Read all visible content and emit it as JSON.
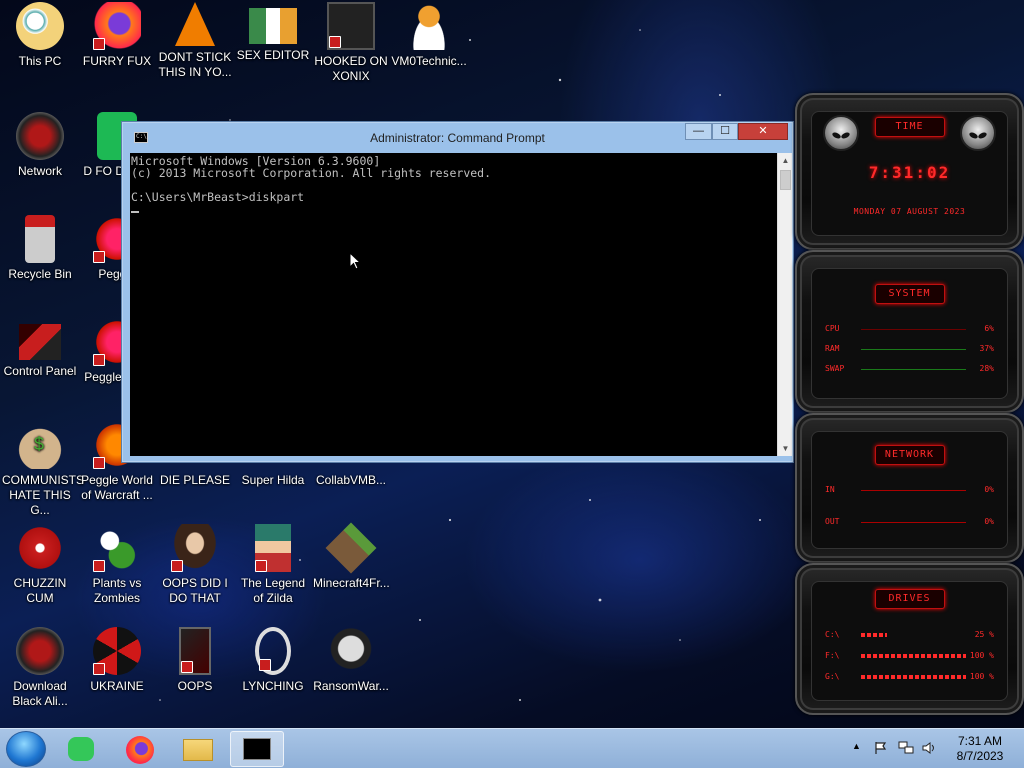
{
  "desktop": {
    "icons": [
      {
        "label": "This PC"
      },
      {
        "label": "FURRY FUX"
      },
      {
        "label": "DONT STICK THIS IN YO..."
      },
      {
        "label": "SEX EDITOR"
      },
      {
        "label": "HOOKED ON XONIX"
      },
      {
        "label": "VM0Technic..."
      },
      {
        "label": "Network"
      },
      {
        "label": "D FO DUMB"
      },
      {
        "label": "Recycle Bin"
      },
      {
        "label": "Peggle"
      },
      {
        "label": "Control Panel"
      },
      {
        "label": "Peggle Delu"
      },
      {
        "label": "COMMUNISTS HATE THIS G..."
      },
      {
        "label": "Peggle World of Warcraft ..."
      },
      {
        "label": "DIE PLEASE"
      },
      {
        "label": "Super Hilda"
      },
      {
        "label": "CollabVMB..."
      },
      {
        "label": "CHUZZIN CUM"
      },
      {
        "label": "Plants vs Zombies"
      },
      {
        "label": "OOPS DID I DO THAT"
      },
      {
        "label": "The Legend of Zilda"
      },
      {
        "label": "Minecraft4Fr..."
      },
      {
        "label": "Download Black Ali..."
      },
      {
        "label": "UKRAINE"
      },
      {
        "label": "OOPS"
      },
      {
        "label": "LYNCHING"
      },
      {
        "label": "RansomWar..."
      }
    ]
  },
  "cmd": {
    "title": "Administrator: Command Prompt",
    "minimize": "—",
    "maximize": "☐",
    "close": "✕",
    "lines": [
      "Microsoft Windows [Version 6.3.9600]",
      "(c) 2013 Microsoft Corporation. All rights reserved.",
      "",
      "C:\\Users\\MrBeast>diskpart"
    ]
  },
  "gadget": {
    "time": {
      "header": "TIME",
      "clock": "7:31:02",
      "date": "MONDAY 07 AUGUST 2023"
    },
    "system": {
      "header": "SYSTEM",
      "rows": [
        {
          "key": "CPU",
          "value": "6%"
        },
        {
          "key": "RAM",
          "value": "37%"
        },
        {
          "key": "SWAP",
          "value": "28%"
        }
      ]
    },
    "network": {
      "header": "NETWORK",
      "rows": [
        {
          "key": "IN",
          "value": "0%"
        },
        {
          "key": "OUT",
          "value": "0%"
        }
      ]
    },
    "drives": {
      "header": "DRIVES",
      "rows": [
        {
          "key": "C:\\",
          "value": "25 %",
          "level": 0.25
        },
        {
          "key": "F:\\",
          "value": "100 %",
          "level": 1.0
        },
        {
          "key": "G:\\",
          "value": "100 %",
          "level": 1.0
        }
      ]
    }
  },
  "taskbar": {
    "clock_time": "7:31 AM",
    "clock_date": "8/7/2023",
    "tray_arrow": "▲"
  }
}
